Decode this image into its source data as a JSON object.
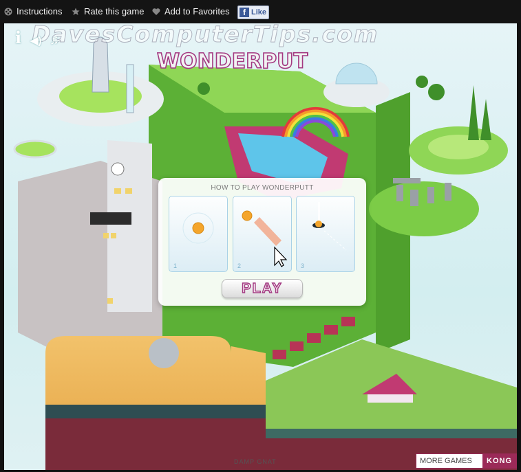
{
  "toolbar": {
    "instructions": "Instructions",
    "rate": "Rate this game",
    "favorites": "Add to Favorites",
    "like": "Like"
  },
  "game": {
    "watermark": "DavesComputerTips.com",
    "logo_text": "WONDERPUTT",
    "info_symbol": "i",
    "sound_symbol": "◀)",
    "music_symbol": "♫",
    "footer_credit": "DAMP GNAT"
  },
  "dialog": {
    "title": "HOW TO PLAY WONDERPUTT",
    "steps": [
      "1",
      "2",
      "3"
    ],
    "play_label": "PLAY"
  },
  "more_games": {
    "label": "MORE GAMES ON",
    "brand": "KONG"
  },
  "colors": {
    "accent": "#a33a82",
    "kong": "#9b2a58",
    "grass": "#7fd24a"
  }
}
